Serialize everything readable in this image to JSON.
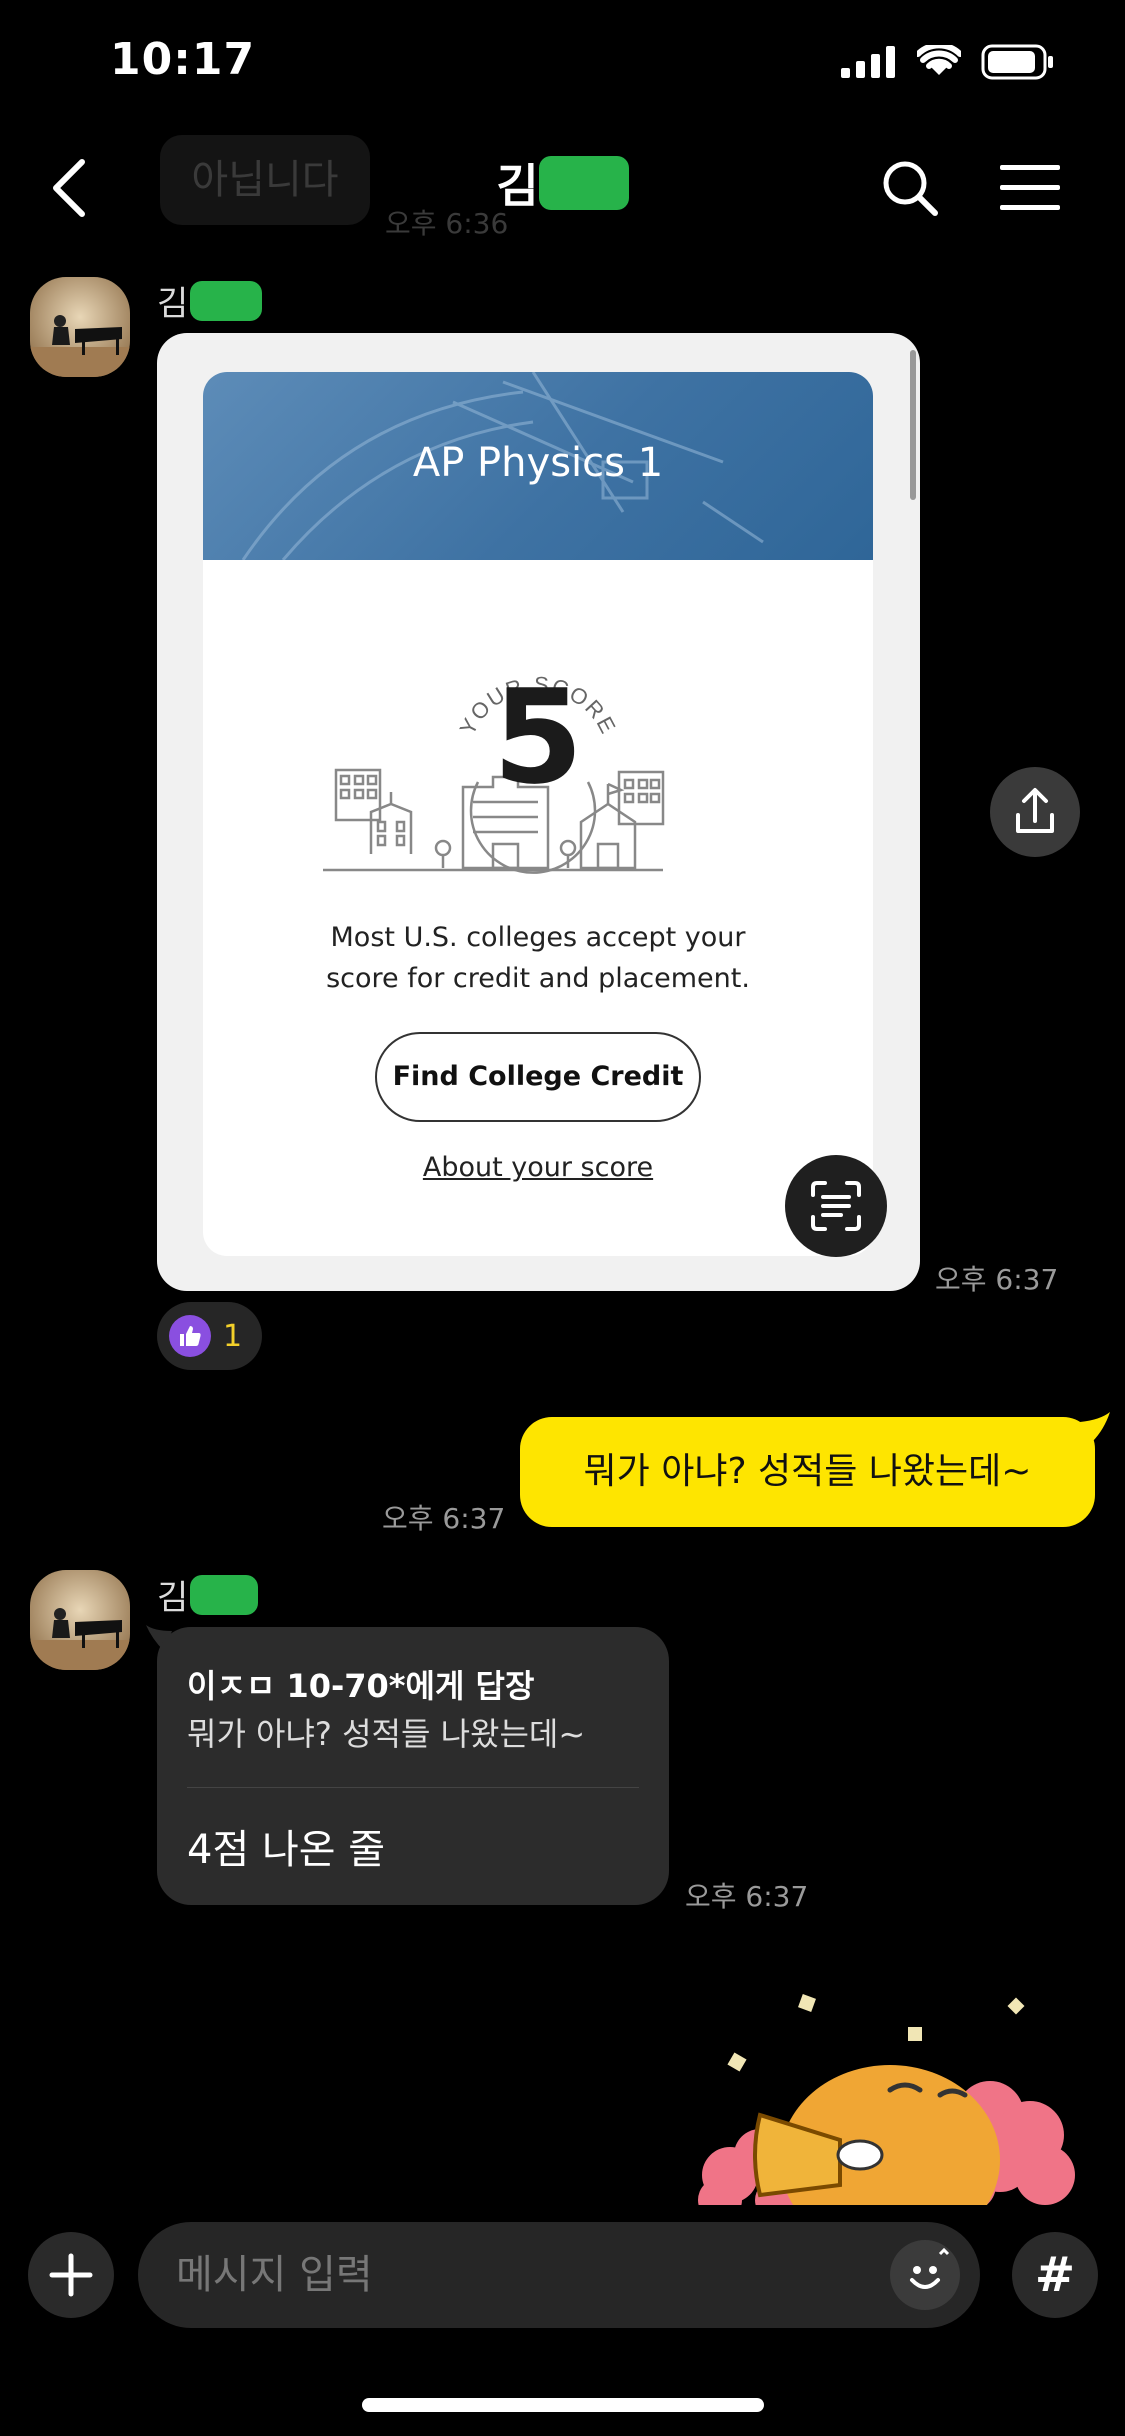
{
  "status": {
    "time": "10:17"
  },
  "header": {
    "ghost_message": "아닙니다",
    "ghost_time": "오후 6:36",
    "title_prefix": "김"
  },
  "messages": {
    "first": {
      "sender_prefix": "김",
      "card_title": "AP Physics 1",
      "score_label": "YOUR SCORE",
      "score": "5",
      "desc_line1": "Most U.S. colleges accept your",
      "desc_line2": "score for credit and placement.",
      "button_label": "Find College Credit",
      "link_label": "About your score",
      "time": "오후 6:37",
      "reaction_count": "1"
    },
    "outgoing": {
      "text": "뭐가 아냐? 성적들 나왔는데~",
      "time": "오후 6:37"
    },
    "reply": {
      "sender_prefix": "김",
      "reply_head": "이ㅈㅁ 10-70*에게 답장",
      "quoted": "뭐가 아냐? 성적들 나왔는데~",
      "text": "4점 나온 줄",
      "time": "오후 6:37"
    }
  },
  "input": {
    "placeholder": "메시지 입력",
    "hash_label": "#"
  },
  "colors": {
    "accent_yellow": "#fee500",
    "redact_green": "#27b34a",
    "reaction_purple": "#8a4fe0"
  },
  "icons": [
    "back-icon",
    "search-icon",
    "menu-icon",
    "share-icon",
    "text-scan-icon",
    "thumbs-up-icon",
    "plus-icon",
    "emoji-icon",
    "hash-icon"
  ]
}
